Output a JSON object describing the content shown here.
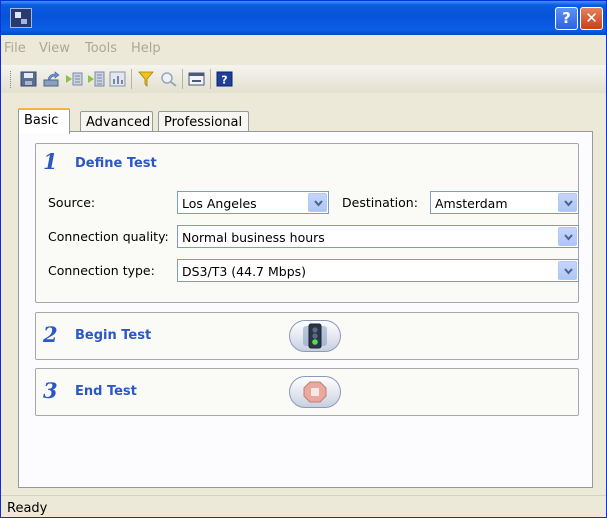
{
  "window": {
    "title": ""
  },
  "titlebar": {
    "help_label": "?",
    "close_label": "✕"
  },
  "menu": [
    {
      "label": "File"
    },
    {
      "label": "View"
    },
    {
      "label": "Tools"
    },
    {
      "label": "Help"
    }
  ],
  "toolbar": {
    "icons": [
      "save-icon",
      "export-icon",
      "import-icon",
      "import-all-icon",
      "chart-icon",
      "filter-icon",
      "search-icon",
      "window-icon",
      "help-icon"
    ]
  },
  "tabs": [
    {
      "label": "Basic",
      "active": true
    },
    {
      "label": "Advanced",
      "active": false
    },
    {
      "label": "Professional",
      "active": false
    }
  ],
  "define": {
    "number": "1",
    "title": "Define Test",
    "source_label": "Source:",
    "source_value": "Los Angeles",
    "destination_label": "Destination:",
    "destination_value": "Amsterdam",
    "quality_label": "Connection quality:",
    "quality_value": "Normal business hours",
    "type_label": "Connection type:",
    "type_value": "DS3/T3 (44.7 Mbps)"
  },
  "begin": {
    "number": "2",
    "title": "Begin Test",
    "button_icon": "traffic-light-icon"
  },
  "end": {
    "number": "3",
    "title": "End Test",
    "button_icon": "stop-icon"
  },
  "status": {
    "text": "Ready"
  },
  "colors": {
    "accent_blue": "#2c57c4",
    "titlebar_blue": "#0653d8",
    "tab_highlight": "#f6b33d"
  }
}
